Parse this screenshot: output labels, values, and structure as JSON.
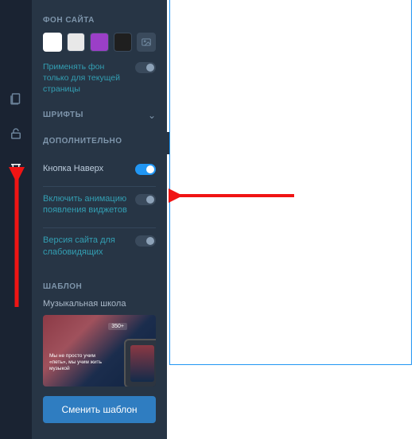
{
  "sections": {
    "background_title": "ФОН САЙТА",
    "apply_bg_current_page": "Применять фон только для текущей страницы",
    "fonts_title": "ШРИФТЫ",
    "additional_title": "ДОПОЛНИТЕЛЬНО",
    "template_title": "ШАБЛОН"
  },
  "settings": {
    "back_to_top": {
      "label": "Кнопка Наверх",
      "on": true
    },
    "widget_anim": {
      "label": "Включить анимацию появления виджетов",
      "on": false
    },
    "accessibility": {
      "label": "Версия сайта для слабовидящих",
      "on": false
    }
  },
  "template": {
    "name": "Музыкальная школа",
    "thumb_caption": "Мы не просто учим «петь», мы учим жить музыкой",
    "thumb_badge": "350+",
    "change_button": "Сменить шаблон"
  },
  "swatches": [
    "white",
    "light",
    "purple",
    "dark",
    "image"
  ],
  "selected_swatch": 0
}
